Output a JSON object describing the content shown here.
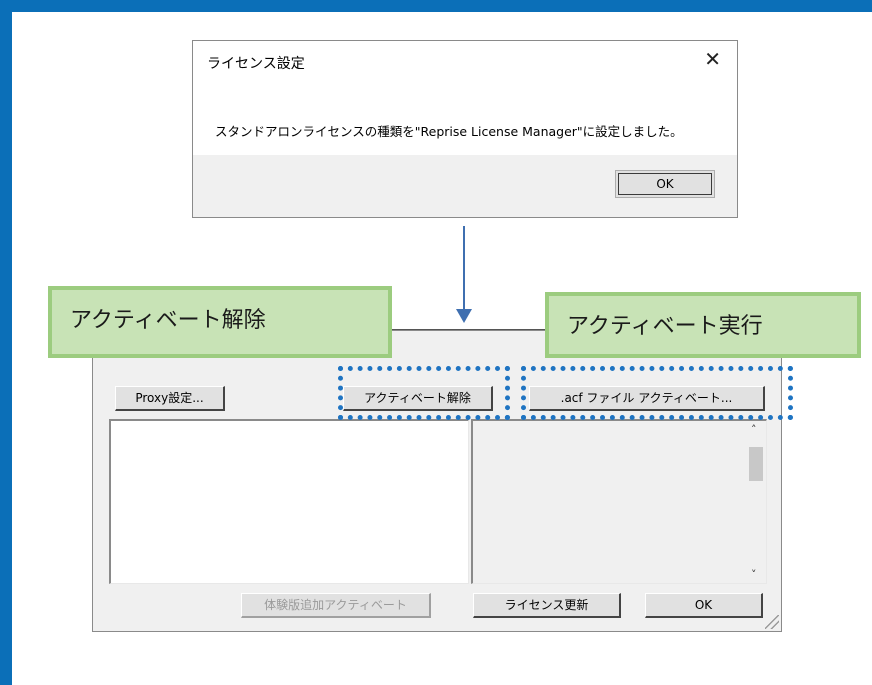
{
  "message_box": {
    "title": "ライセンス設定",
    "close_glyph": "✕",
    "message": "スタンドアロンライセンスの種類を\"Reprise License Manager\"に設定しました。",
    "ok_label": "OK"
  },
  "dialog": {
    "proxy_button": "Proxy設定...",
    "deactivate_button": "アクティベート解除",
    "acf_activate_button": ".acf ファイル アクティベート...",
    "trial_activate_button": "体験版追加アクティベート",
    "license_update_button": "ライセンス更新",
    "ok_label": "OK",
    "scroll_up_glyph": "˄",
    "scroll_down_glyph": "˅"
  },
  "callouts": {
    "deactivate": "アクティベート解除",
    "activate": "アクティベート実行"
  },
  "colors": {
    "frame": "#0b6fb8",
    "callout_fill": "#c8e3b6",
    "callout_border": "#9ccc7f",
    "highlight_dots": "#1f74c2",
    "arrow": "#3f6fb0"
  }
}
